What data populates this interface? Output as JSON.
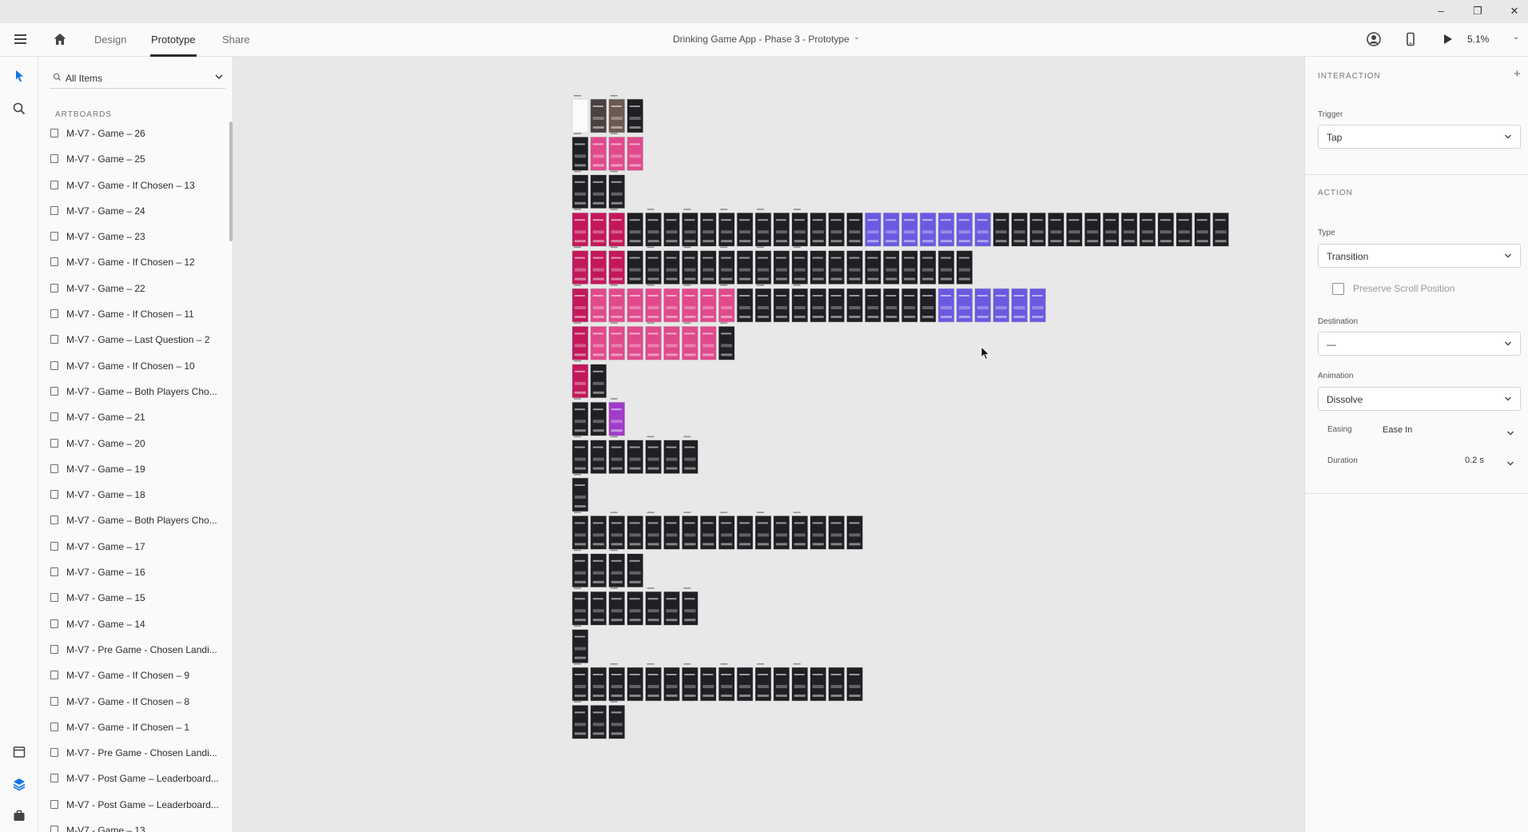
{
  "window": {
    "minimize": "–",
    "restore": "❐",
    "close": "✕"
  },
  "toolbar": {
    "tabs": [
      {
        "label": "Design"
      },
      {
        "label": "Prototype"
      },
      {
        "label": "Share"
      }
    ],
    "active_tab": "Prototype",
    "document_title": "Drinking Game App - Phase 3 - Prototype",
    "zoom": "5.1%"
  },
  "icons": {
    "menu": "hamburger-menu-icon",
    "home": "home-icon",
    "user": "user-icon",
    "device": "mobile-device-icon",
    "play": "play-icon",
    "select": "select-arrow-icon",
    "search": "search-icon",
    "assets": "assets-icon",
    "layers": "layers-icon",
    "plugins": "plugins-icon"
  },
  "layers_panel": {
    "filter": "All Items",
    "section_label": "ARTBOARDS",
    "artboards": [
      "M-V7 - Game – 26",
      "M-V7 - Game – 25",
      "M-V7 - Game - If Chosen – 13",
      "M-V7 - Game – 24",
      "M-V7 - Game – 23",
      "M-V7 - Game - If Chosen – 12",
      "M-V7 - Game – 22",
      "M-V7 - Game - If Chosen – 11",
      "M-V7 - Game – Last Question – 2",
      "M-V7 - Game - If Chosen – 10",
      "M-V7 - Game – Both Players Cho...",
      "M-V7 - Game – 21",
      "M-V7 - Game – 20",
      "M-V7 - Game – 19",
      "M-V7 - Game – 18",
      "M-V7 - Game – Both Players Cho...",
      "M-V7 - Game – 17",
      "M-V7 - Game – 16",
      "M-V7 - Game – 15",
      "M-V7 - Game – 14",
      "M-V7 - Pre Game - Chosen Landi...",
      "M-V7 - Game - If Chosen – 9",
      "M-V7 - Game - If Chosen – 8",
      "M-V7 - Game - If Chosen – 1",
      "M-V7 - Pre Game - Chosen Landi...",
      "M-V7 - Post Game – Leaderboard...",
      "M-V7 - Post Game – Leaderboard...",
      "M-V7 - Game – 13"
    ]
  },
  "inspector": {
    "interaction_title": "INTERACTION",
    "add": "+",
    "trigger_label": "Trigger",
    "trigger_value": "Tap",
    "action_title": "ACTION",
    "type_label": "Type",
    "type_value": "Transition",
    "preserve_scroll_label": "Preserve Scroll Position",
    "destination_label": "Destination",
    "destination_value": "—",
    "animation_label": "Animation",
    "animation_value": "Dissolve",
    "easing_label": "Easing",
    "easing_value": "Ease In",
    "duration_label": "Duration",
    "duration_value": "0.2 s"
  },
  "canvas": {
    "rows": [
      {
        "colors": [
          "#fbfbfb",
          "#4a4040",
          "#6b5a52",
          "#1f1f24"
        ]
      },
      {
        "colors": [
          "#1f1f24",
          "#e04a8c",
          "#e04a8c",
          "#e04a8c"
        ]
      },
      {
        "colors": [
          "#1f1f24",
          "#1f1f24",
          "#1f1f24"
        ]
      },
      {
        "colors": [
          "#c2185b",
          "#c2185b",
          "#c2185b",
          "#1f1f24",
          "#1f1f24",
          "#1f1f24",
          "#1f1f24",
          "#1f1f24",
          "#1f1f24",
          "#1f1f24",
          "#1f1f24",
          "#1f1f24",
          "#1f1f24",
          "#1f1f24",
          "#1f1f24",
          "#1f1f24",
          "#6a5ae0",
          "#6a5ae0",
          "#6a5ae0",
          "#6a5ae0",
          "#6a5ae0",
          "#6a5ae0",
          "#6a5ae0",
          "#1f1f24",
          "#1f1f24",
          "#1f1f24",
          "#1f1f24",
          "#1f1f24",
          "#1f1f24",
          "#1f1f24",
          "#1f1f24",
          "#1f1f24",
          "#1f1f24",
          "#1f1f24",
          "#1f1f24",
          "#1f1f24"
        ]
      },
      {
        "colors": [
          "#c2185b",
          "#c2185b",
          "#c2185b",
          "#1f1f24",
          "#1f1f24",
          "#1f1f24",
          "#1f1f24",
          "#1f1f24",
          "#1f1f24",
          "#1f1f24",
          "#1f1f24",
          "#1f1f24",
          "#1f1f24",
          "#1f1f24",
          "#1f1f24",
          "#1f1f24",
          "#1f1f24",
          "#1f1f24",
          "#1f1f24",
          "#1f1f24",
          "#1f1f24",
          "#1f1f24"
        ]
      },
      {
        "colors": [
          "#c2185b",
          "#e04a8c",
          "#e04a8c",
          "#e04a8c",
          "#e04a8c",
          "#e04a8c",
          "#e04a8c",
          "#e04a8c",
          "#e04a8c",
          "#1f1f24",
          "#1f1f24",
          "#1f1f24",
          "#1f1f24",
          "#1f1f24",
          "#1f1f24",
          "#1f1f24",
          "#1f1f24",
          "#1f1f24",
          "#1f1f24",
          "#1f1f24",
          "#6a5ae0",
          "#6a5ae0",
          "#6a5ae0",
          "#6a5ae0",
          "#6a5ae0",
          "#6a5ae0"
        ]
      },
      {
        "colors": [
          "#c2185b",
          "#e04a8c",
          "#e04a8c",
          "#e04a8c",
          "#e04a8c",
          "#e04a8c",
          "#e04a8c",
          "#e04a8c",
          "#1f1f24"
        ]
      },
      {
        "colors": [
          "#c2185b",
          "#1f1f24"
        ]
      },
      {
        "colors": [
          "#1f1f24",
          "#1f1f24",
          "#a03cc8"
        ]
      },
      {
        "colors": [
          "#1f1f24",
          "#1f1f24",
          "#1f1f24",
          "#1f1f24",
          "#1f1f24",
          "#1f1f24",
          "#1f1f24"
        ]
      },
      {
        "colors": [
          "#1f1f24"
        ]
      },
      {
        "colors": [
          "#1f1f24",
          "#1f1f24",
          "#1f1f24",
          "#1f1f24",
          "#1f1f24",
          "#1f1f24",
          "#1f1f24",
          "#1f1f24",
          "#1f1f24",
          "#1f1f24",
          "#1f1f24",
          "#1f1f24",
          "#1f1f24",
          "#1f1f24",
          "#1f1f24",
          "#1f1f24"
        ]
      },
      {
        "colors": [
          "#1f1f24",
          "#1f1f24",
          "#1f1f24",
          "#1f1f24"
        ]
      },
      {
        "colors": [
          "#1f1f24",
          "#1f1f24",
          "#1f1f24",
          "#1f1f24",
          "#1f1f24",
          "#1f1f24",
          "#1f1f24"
        ]
      },
      {
        "colors": [
          "#1f1f24"
        ]
      },
      {
        "colors": [
          "#1f1f24",
          "#1f1f24",
          "#1f1f24",
          "#1f1f24",
          "#1f1f24",
          "#1f1f24",
          "#1f1f24",
          "#1f1f24",
          "#1f1f24",
          "#1f1f24",
          "#1f1f24",
          "#1f1f24",
          "#1f1f24",
          "#1f1f24",
          "#1f1f24",
          "#1f1f24"
        ]
      },
      {
        "colors": [
          "#1f1f24",
          "#1f1f24",
          "#1f1f24"
        ]
      }
    ]
  }
}
